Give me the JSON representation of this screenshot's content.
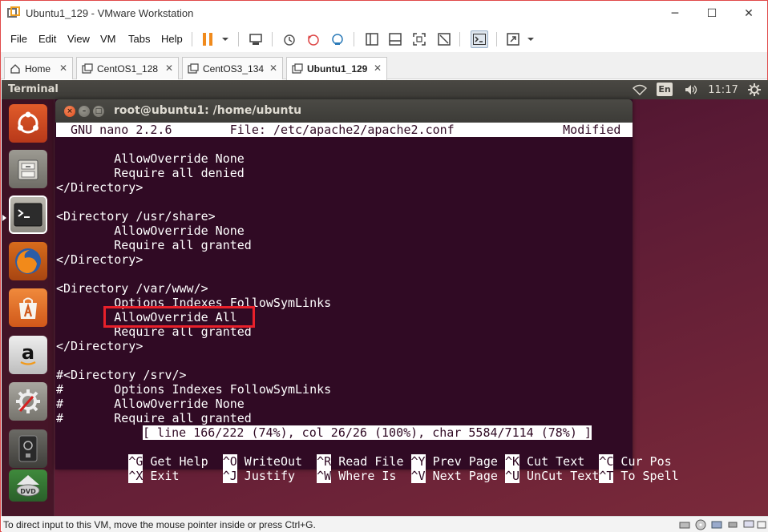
{
  "window": {
    "title": "Ubuntu1_129 - VMware Workstation",
    "controls": {
      "minimize": "─",
      "maximize": "☐",
      "close": "✕"
    }
  },
  "menubar": {
    "items": [
      "File",
      "Edit",
      "View",
      "VM",
      "Tabs",
      "Help"
    ]
  },
  "tabs": [
    {
      "label": "Home",
      "icon": "home-icon",
      "active": false
    },
    {
      "label": "CentOS1_128",
      "icon": "vm-icon",
      "active": false
    },
    {
      "label": "CentOS3_134",
      "icon": "vm-icon",
      "active": false
    },
    {
      "label": "Ubuntu1_129",
      "icon": "vm-icon",
      "active": true
    }
  ],
  "ubuntu_panel": {
    "app_title": "Terminal",
    "lang": "En",
    "clock": "11:17"
  },
  "launcher": [
    "ubuntu-dash-icon",
    "files-icon",
    "terminal-icon",
    "firefox-icon",
    "software-center-icon",
    "amazon-icon",
    "system-settings-icon",
    "usb-drive-icon",
    "dvd-icon"
  ],
  "terminal": {
    "title": "root@ubuntu1: /home/ubuntu",
    "nano_header": "  GNU nano 2.2.6        File: /etc/apache2/apache2.conf               Modified  ",
    "lines": [
      "",
      "        AllowOverride None",
      "        Require all denied",
      "</Directory>",
      "",
      "<Directory /usr/share>",
      "        AllowOverride None",
      "        Require all granted",
      "</Directory>",
      "",
      "<Directory /var/www/>",
      "        Options Indexes FollowSymLinks",
      "        AllowOverride All",
      "        Require all granted",
      "</Directory>",
      "",
      "#<Directory /srv/>",
      "#       Options Indexes FollowSymLinks",
      "#       AllowOverride None",
      "#       Require all granted"
    ],
    "status_line": "[ line 166/222 (74%), col 26/26 (100%), char 5584/7114 (78%) ]",
    "shortcuts_row1": [
      {
        "key": "^G",
        "label": " Get Help  "
      },
      {
        "key": "^O",
        "label": " WriteOut  "
      },
      {
        "key": "^R",
        "label": " Read File "
      },
      {
        "key": "^Y",
        "label": " Prev Page "
      },
      {
        "key": "^K",
        "label": " Cut Text  "
      },
      {
        "key": "^C",
        "label": " Cur Pos"
      }
    ],
    "shortcuts_row2": [
      {
        "key": "^X",
        "label": " Exit      "
      },
      {
        "key": "^J",
        "label": " Justify   "
      },
      {
        "key": "^W",
        "label": " Where Is  "
      },
      {
        "key": "^V",
        "label": " Next Page "
      },
      {
        "key": "^U",
        "label": " UnCut Text"
      },
      {
        "key": "^T",
        "label": " To Spell"
      }
    ]
  },
  "statusbar": {
    "text": "To direct input to this VM, move the mouse pointer inside or press Ctrl+G."
  },
  "colors": {
    "terminal_bg": "#300a24",
    "highlight": "#e8202a",
    "window_border": "#e04a4a"
  }
}
